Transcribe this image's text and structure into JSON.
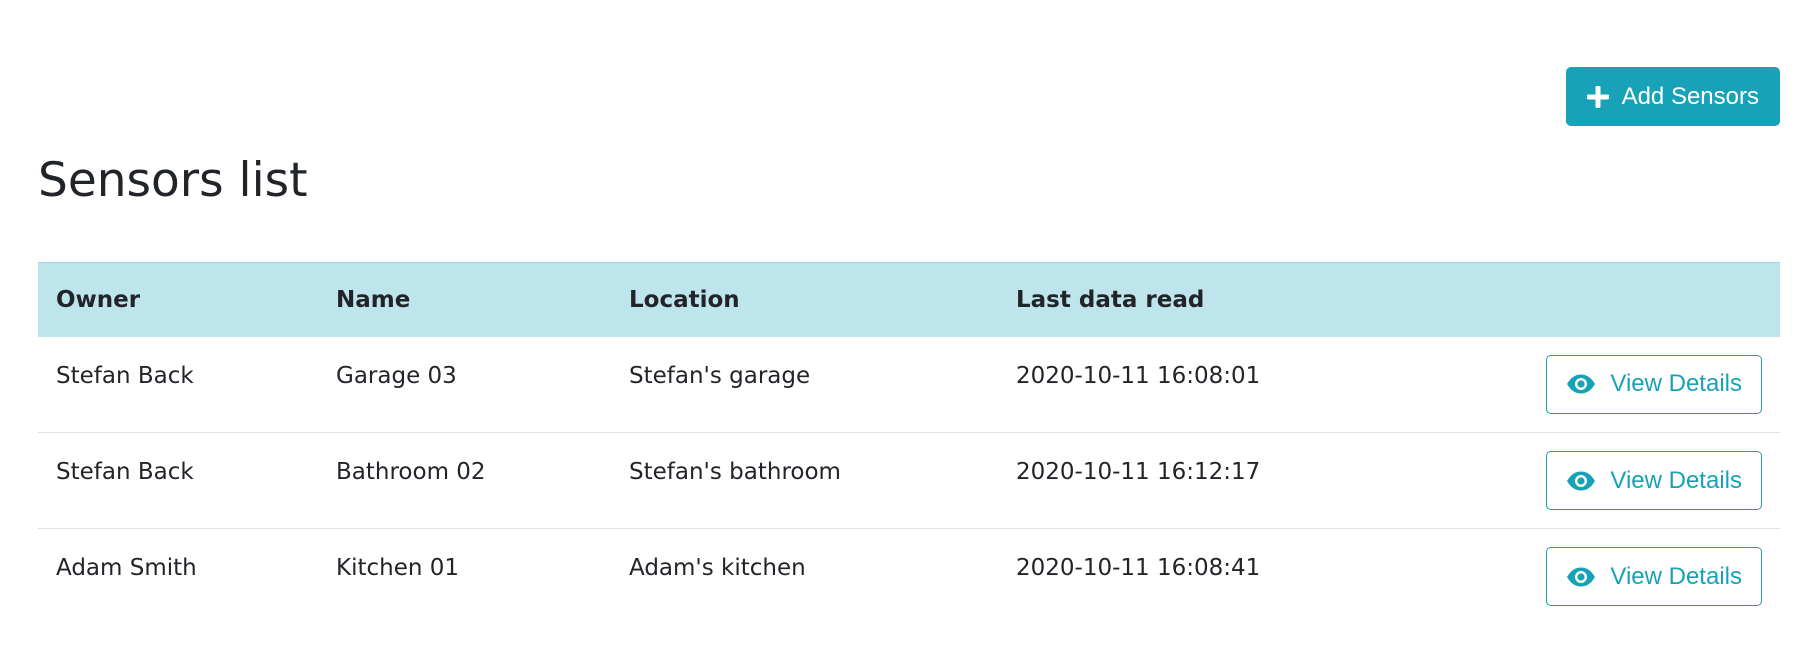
{
  "header": {
    "add_button_label": "Add Sensors",
    "add_button_icon": "plus-icon",
    "title": "Sensors list"
  },
  "colors": {
    "accent": "#17a2b8",
    "table_header_bg": "#bee5eb"
  },
  "table": {
    "columns": {
      "owner": "Owner",
      "name": "Name",
      "location": "Location",
      "last_data_read": "Last data read"
    },
    "rows": [
      {
        "owner": "Stefan Back",
        "name": "Garage 03",
        "location": "Stefan's garage",
        "last_data_read": "2020-10-11 16:08:01",
        "action_label": "View Details",
        "action_icon": "eye-icon"
      },
      {
        "owner": "Stefan Back",
        "name": "Bathroom 02",
        "location": "Stefan's bathroom",
        "last_data_read": "2020-10-11 16:12:17",
        "action_label": "View Details",
        "action_icon": "eye-icon"
      },
      {
        "owner": "Adam Smith",
        "name": "Kitchen 01",
        "location": "Adam's kitchen",
        "last_data_read": "2020-10-11 16:08:41",
        "action_label": "View Details",
        "action_icon": "eye-icon"
      }
    ]
  }
}
